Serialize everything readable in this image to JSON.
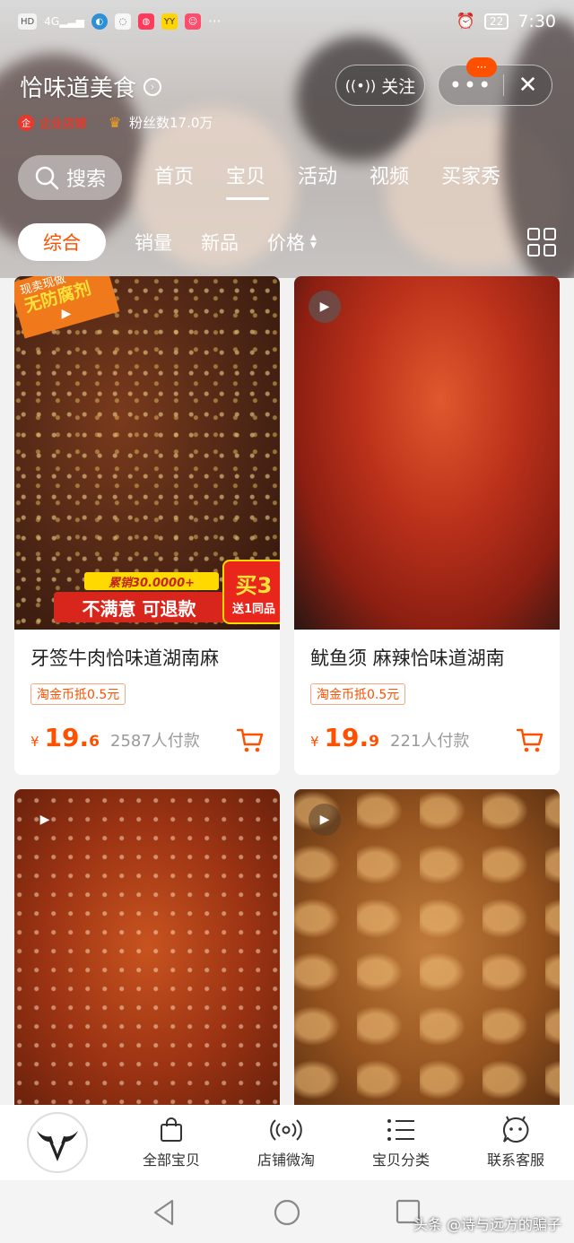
{
  "status_bar": {
    "time": "7:30",
    "battery": "22",
    "hd_label": "HD",
    "signal_label": "4G"
  },
  "shop": {
    "name": "恰味道美食",
    "enterprise_label": "企业店铺",
    "fans_label": "粉丝数17.0万",
    "follow_label": "关注",
    "more_label": "•••",
    "close_label": "✕",
    "notify_badge": "···"
  },
  "tabs": {
    "search_label": "搜索",
    "items": [
      {
        "label": "首页",
        "active": false
      },
      {
        "label": "宝贝",
        "active": true
      },
      {
        "label": "活动",
        "active": false
      },
      {
        "label": "视频",
        "active": false
      },
      {
        "label": "买家秀",
        "active": false
      }
    ]
  },
  "sort": {
    "items": [
      {
        "label": "综合",
        "active": true
      },
      {
        "label": "销量",
        "active": false
      },
      {
        "label": "新品",
        "active": false
      },
      {
        "label": "价格",
        "active": false
      }
    ]
  },
  "products": [
    {
      "title": "牙签牛肉恰味道湖南麻",
      "coin": "淘金币抵0.5元",
      "currency": "¥",
      "price_int": "19.",
      "price_dec": "6",
      "sold": "2587人付款",
      "corner_top": "现卖现做",
      "corner_main": "无防腐剂",
      "promo_top": "累销30.0000+",
      "promo_main": "不满意  可退款",
      "promo_buy": "买3",
      "promo_gift": "送1同品"
    },
    {
      "title": "鱿鱼须  麻辣恰味道湖南",
      "coin": "淘金币抵0.5元",
      "currency": "¥",
      "price_int": "19.",
      "price_dec": "9",
      "sold": "221人付款"
    }
  ],
  "shop_nav": {
    "items": [
      {
        "label": "全部宝贝",
        "icon": "shopping-bag-icon"
      },
      {
        "label": "店铺微淘",
        "icon": "broadcast-icon"
      },
      {
        "label": "宝贝分类",
        "icon": "list-icon"
      },
      {
        "label": "联系客服",
        "icon": "chat-face-icon"
      }
    ]
  },
  "watermark": "头条 @诗与远方的骗子",
  "colors": {
    "accent": "#ff5000",
    "price": "#ff5000",
    "enterprise": "#e8392b"
  }
}
